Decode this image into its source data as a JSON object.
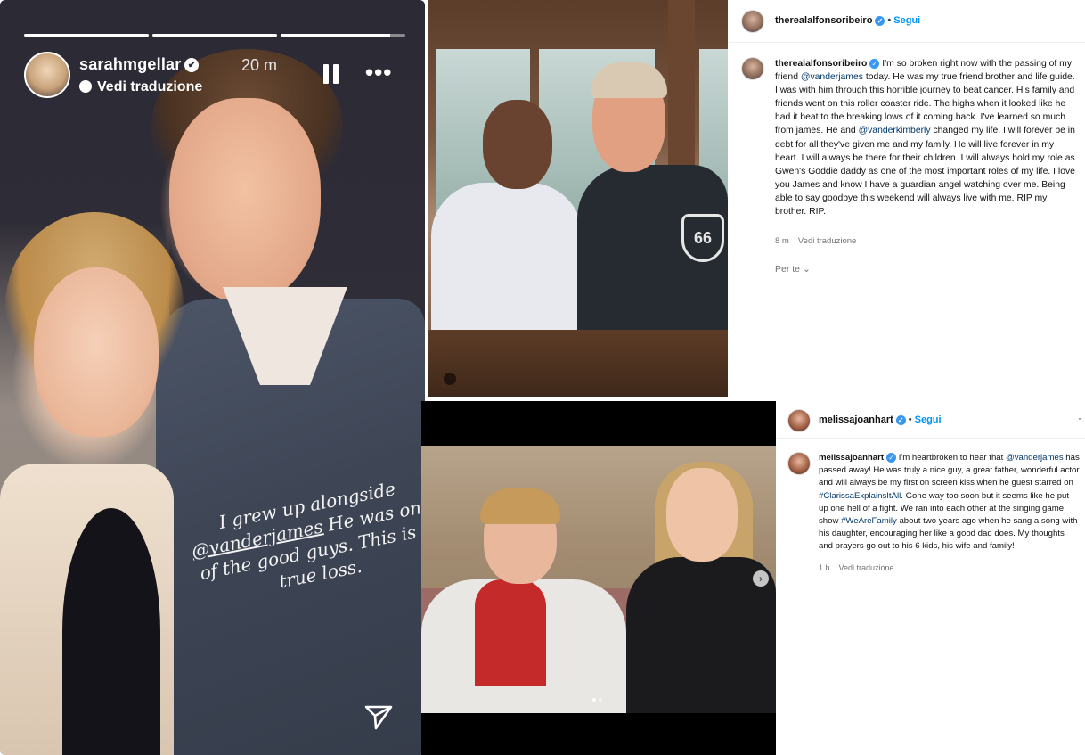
{
  "story": {
    "username": "sarahmgellar",
    "verified_glyph": "✔",
    "time": "20 m",
    "translate_label": "Vedi traduzione",
    "more_label": "•••",
    "progress_segments": [
      1.0,
      1.0,
      0.88
    ],
    "caption_line1": "I grew up alongside",
    "caption_mention": "@vanderjames",
    "caption_line2_rest": " He was one",
    "caption_line3": "of the good guys. This is a",
    "caption_line4": "true loss.",
    "icons": [
      "pause-icon",
      "more-icon",
      "send-icon",
      "translate-icon"
    ]
  },
  "post1": {
    "header_username": "therealalfonsoribeiro",
    "follow_label": "Segui",
    "dot": "•",
    "caption_username": "therealalfonsoribeiro",
    "caption_a": " I'm so broken right now with the passing of my friend ",
    "mention1": "@vanderjames",
    "caption_b": " today. He was my true friend brother and life guide. I was with him through this horrible journey to beat cancer. His family and friends went on this roller coaster ride. The highs when it looked like he had it beat to the breaking lows of it coming back. I've learned so much from james. He and ",
    "mention2": "@vanderkimberly",
    "caption_c": " changed my life. I will forever be in debt for all they've given me and my family. He will live forever in my heart. I will always be there for their children. I will always hold my role as Gwen's Goddie daddy as one of the most important roles of my life. I love you James and know I have a guardian angel watching over me. Being able to say goodbye this weekend will always live with me. RIP my brother. RIP.",
    "time": "8 m",
    "translate_label": "Vedi traduzione",
    "per_te_label": "Per te",
    "photo_badge": "66"
  },
  "post2": {
    "header_username": "melissajoanhart",
    "follow_label": "Segui",
    "dot": "•",
    "more_label": "·",
    "caption_username": "melissajoanhart",
    "caption_a": " I'm heartbroken to hear that ",
    "mention1": "@vanderjames",
    "caption_b": " has passed away! He was truly a nice guy, a great father, wonderful actor and will always be my first on screen kiss when he guest starred on ",
    "hashtag1": "#ClarissaExplainsItAll",
    "caption_c": ". Gone way too soon but it seems like he put up one hell of a fight. We ran into each other at the singing game show ",
    "hashtag2": "#WeAreFamily",
    "caption_d": " about two years ago when he sang a song with his daughter, encouraging her like a good dad does. My thoughts and prayers go out to his 6 kids, his wife and family!",
    "time": "1 h",
    "translate_label": "Vedi traduzione",
    "carousel_next": "›",
    "carousel_slide": 1,
    "carousel_total": 2
  },
  "colors": {
    "link": "#00376b",
    "follow": "#0095f6",
    "verified": "#3897f0",
    "meta": "#737373"
  }
}
